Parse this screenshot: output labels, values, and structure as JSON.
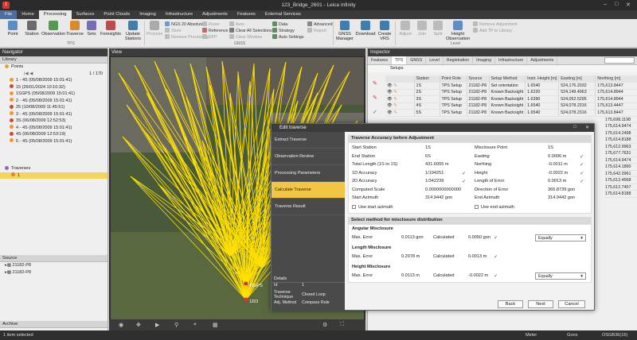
{
  "window": {
    "title": "123_Bridge_2601 - Leica Infinity"
  },
  "menu": [
    "File",
    "Home",
    "Processing",
    "Surfaces",
    "Point Clouds",
    "Imaging",
    "Infrastructure",
    "Adjustments",
    "Features",
    "External Services"
  ],
  "ribbon": {
    "tps_buttons": [
      "Point",
      "Station",
      "Observation",
      "Traverse",
      "Sets",
      "Foresights",
      "Update Stations"
    ],
    "tps_group": "TPS",
    "gnss_small": [
      "NGS 20 Absolute",
      "Store",
      "Remove Processing",
      "Rover",
      "Reference",
      "SPP",
      "Auto",
      "Clear All Selections",
      "Clear Window"
    ],
    "gnss_group": "GNSS",
    "process_label": "Process",
    "data_small": [
      "Data",
      "Strategy",
      "Auto Settings"
    ],
    "advanced_small": [
      "Advanced",
      "Report"
    ],
    "big2": [
      "GNSS Manager",
      "Download",
      "Create VRS"
    ],
    "level_buttons": [
      "Adjust",
      "Join",
      "Split",
      "Height Observation"
    ],
    "level_group": "Level",
    "level_small": [
      "Remove Adjustment",
      "Add TP to Library"
    ]
  },
  "navigator": {
    "title": "Navigator",
    "library_label": "Library",
    "points_label": "Points",
    "counter": "1 / 170",
    "points": [
      "1 - 4S (05/08/2009 15:01:41)",
      "15 (26/01/2024 10:10:32)",
      "1SGPS (05/08/2009 15:01:41)",
      "2 - 4S (05/08/2009 15:01:41)",
      "25 (10/08/2009 11:45:51)",
      "3 - 4S (05/08/2009 15:01:41)",
      "3S (06/08/2009 12:52:53)",
      "4 - 4S (05/08/2009 15:01:41)",
      "4S (06/08/2009 12:53:19)",
      "5 - 4S (05/08/2009 15:01:41)"
    ],
    "traverses_label": "Traverses",
    "traverse_item": "1",
    "source_label": "Source",
    "source_items": [
      "21182-P8",
      "21182-P8"
    ],
    "archive_label": "Archive"
  },
  "view": {
    "title": "View",
    "labels": [
      "1SGPS",
      "1203"
    ]
  },
  "inspector": {
    "title": "Inspector",
    "tabs": [
      "Features",
      "TPS",
      "GNSS",
      "Level",
      "Registration",
      "Imaging",
      "Infrastructure",
      "Adjustments"
    ],
    "subtab": "Setups",
    "columns": [
      "Station",
      "Point Role",
      "Source",
      "Setup Method",
      "Instr. Height [m]",
      "Easting [m]",
      "Northing [m]"
    ],
    "rows": [
      [
        "1S",
        "TPS Setup",
        "21182-P8",
        "Set orientation",
        "1.6540",
        "524,176.2032",
        "175,613.8447"
      ],
      [
        "2S",
        "TPS Setup",
        "21182-P8",
        "Known Backsight",
        "1.6220",
        "524,149.4963",
        "175,614.8944"
      ],
      [
        "3S",
        "TPS Setup",
        "21182-P8",
        "Known Backsight",
        "1.6390",
        "524,052.5295",
        "175,614.8944"
      ],
      [
        "4S",
        "TPS Setup",
        "21182-P8",
        "Known Backsight",
        "1.6540",
        "524,078.2316",
        "175,613.4447"
      ],
      [
        "5S",
        "TPS Setup",
        "21182-P8",
        "Known Backsight",
        "1.6540",
        "524,078.2316",
        "175,613.8447"
      ]
    ],
    "extra_northing": [
      "175,698.1198",
      "175,614.9474",
      "175,614.2498",
      "175,614.8188",
      "175,612.9963",
      "175,677.7631",
      "175,614.9474",
      "175,614.1890",
      "175,642.3961",
      "175,612.4568",
      "175,612.7457",
      "175,614.8188"
    ]
  },
  "dialog": {
    "title": "Edit traverse",
    "steps": [
      "Extract Traverse",
      "Observation Review",
      "Processing Parameters",
      "Calculate Traverse",
      "Traverse Result"
    ],
    "active_step": "Calculate Traverse",
    "details": {
      "title": "Details",
      "id_label": "Id",
      "id_value": "1",
      "technique_label": "Traverse Technique",
      "technique_value": "Closed Loop",
      "method_label": "Adj. Method",
      "method_value": "Compass Rule"
    },
    "accuracy_title": "Traverse Accuracy before Adjustment",
    "left_fields": [
      {
        "label": "Start Station",
        "value": "1S"
      },
      {
        "label": "End Station",
        "value": "6S"
      },
      {
        "label": "Total Length (1S to 1S)",
        "value": "431.6005 m"
      },
      {
        "label": "1D Accuracy",
        "value": "1/194251"
      },
      {
        "label": "2D Accuracy",
        "value": "1/342239"
      },
      {
        "label": "Computed Scale",
        "value": "0.0000000000000"
      },
      {
        "label": "Start Azimuth",
        "value": "314.9442 gon"
      }
    ],
    "use_start_azimuth": "Use start azimuth",
    "right_fields": [
      {
        "label": "Misclosure Point",
        "value": "1S"
      },
      {
        "label": "Easting",
        "value": "0.0006 m"
      },
      {
        "label": "Northing",
        "value": "-0.0011 m"
      },
      {
        "label": "Height",
        "value": "-0.0022 m"
      },
      {
        "label": "Length of Error",
        "value": "0.0013 m"
      },
      {
        "label": "Direction of Error",
        "value": "365.8739 gon"
      },
      {
        "label": "End Azimuth",
        "value": "314.9442 gon"
      }
    ],
    "use_end_azimuth": "Use end azimuth",
    "method_title": "Select method for misclosure distribution",
    "angular": {
      "title": "Angular Misclosure",
      "max_error_label": "Max. Error",
      "max_error_value": "0.0113 gon",
      "calc_label": "Calculated",
      "calc_value": "0.0050 gon",
      "method": "Equally"
    },
    "length": {
      "title": "Length Misclosure",
      "max_error_label": "Max. Error",
      "max_error_value": "0.2078 m",
      "calc_label": "Calculated",
      "calc_value": "0.0013 m"
    },
    "height": {
      "title": "Height Misclosure",
      "max_error_label": "Max. Error",
      "max_error_value": "0.0113 m",
      "calc_label": "Calculated",
      "calc_value": "-0.0022 m",
      "method": "Equally"
    },
    "buttons": {
      "back": "Back",
      "next": "Next",
      "cancel": "Cancel"
    }
  },
  "status": {
    "selected": "1 item selected",
    "unit_len": "Meter",
    "unit_ang": "Gons",
    "code": "OSGB36(15)"
  }
}
